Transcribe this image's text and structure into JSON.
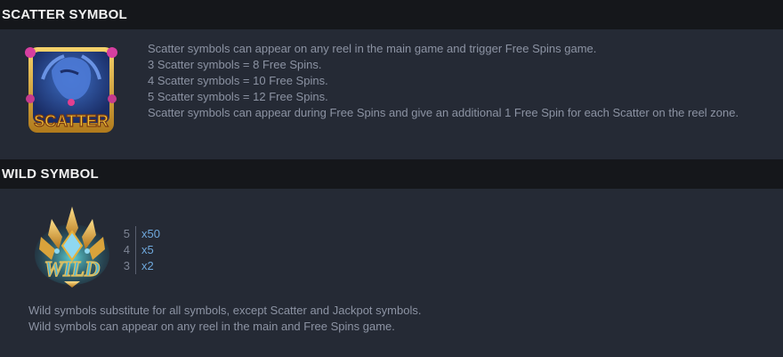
{
  "scatter": {
    "title": "SCATTER SYMBOL",
    "icon": "scatter-symbol-icon",
    "icon_label": "SCATTER",
    "lines": [
      "Scatter symbols can appear on any reel in the main game and trigger Free Spins game.",
      "3 Scatter symbols = 8 Free Spins.",
      "4 Scatter symbols = 10 Free Spins.",
      "5 Scatter symbols = 12 Free Spins.",
      "Scatter symbols can appear during Free Spins and give an additional 1 Free Spin for each Scatter on the reel zone."
    ]
  },
  "wild": {
    "title": "WILD SYMBOL",
    "icon": "wild-symbol-icon",
    "icon_label": "WILD",
    "paytable": [
      {
        "count": "5",
        "multiplier": "x50"
      },
      {
        "count": "4",
        "multiplier": "x5"
      },
      {
        "count": "3",
        "multiplier": "x2"
      }
    ],
    "lines": [
      "Wild symbols substitute for all symbols, except Scatter and Jackpot symbols.",
      "Wild symbols can appear on any reel in the main and Free Spins game."
    ]
  },
  "colors": {
    "background": "#252a35",
    "header": "#15171b",
    "text": "#8c93a3",
    "multiplier": "#6fa8dc",
    "gold": "#e6b23a"
  }
}
